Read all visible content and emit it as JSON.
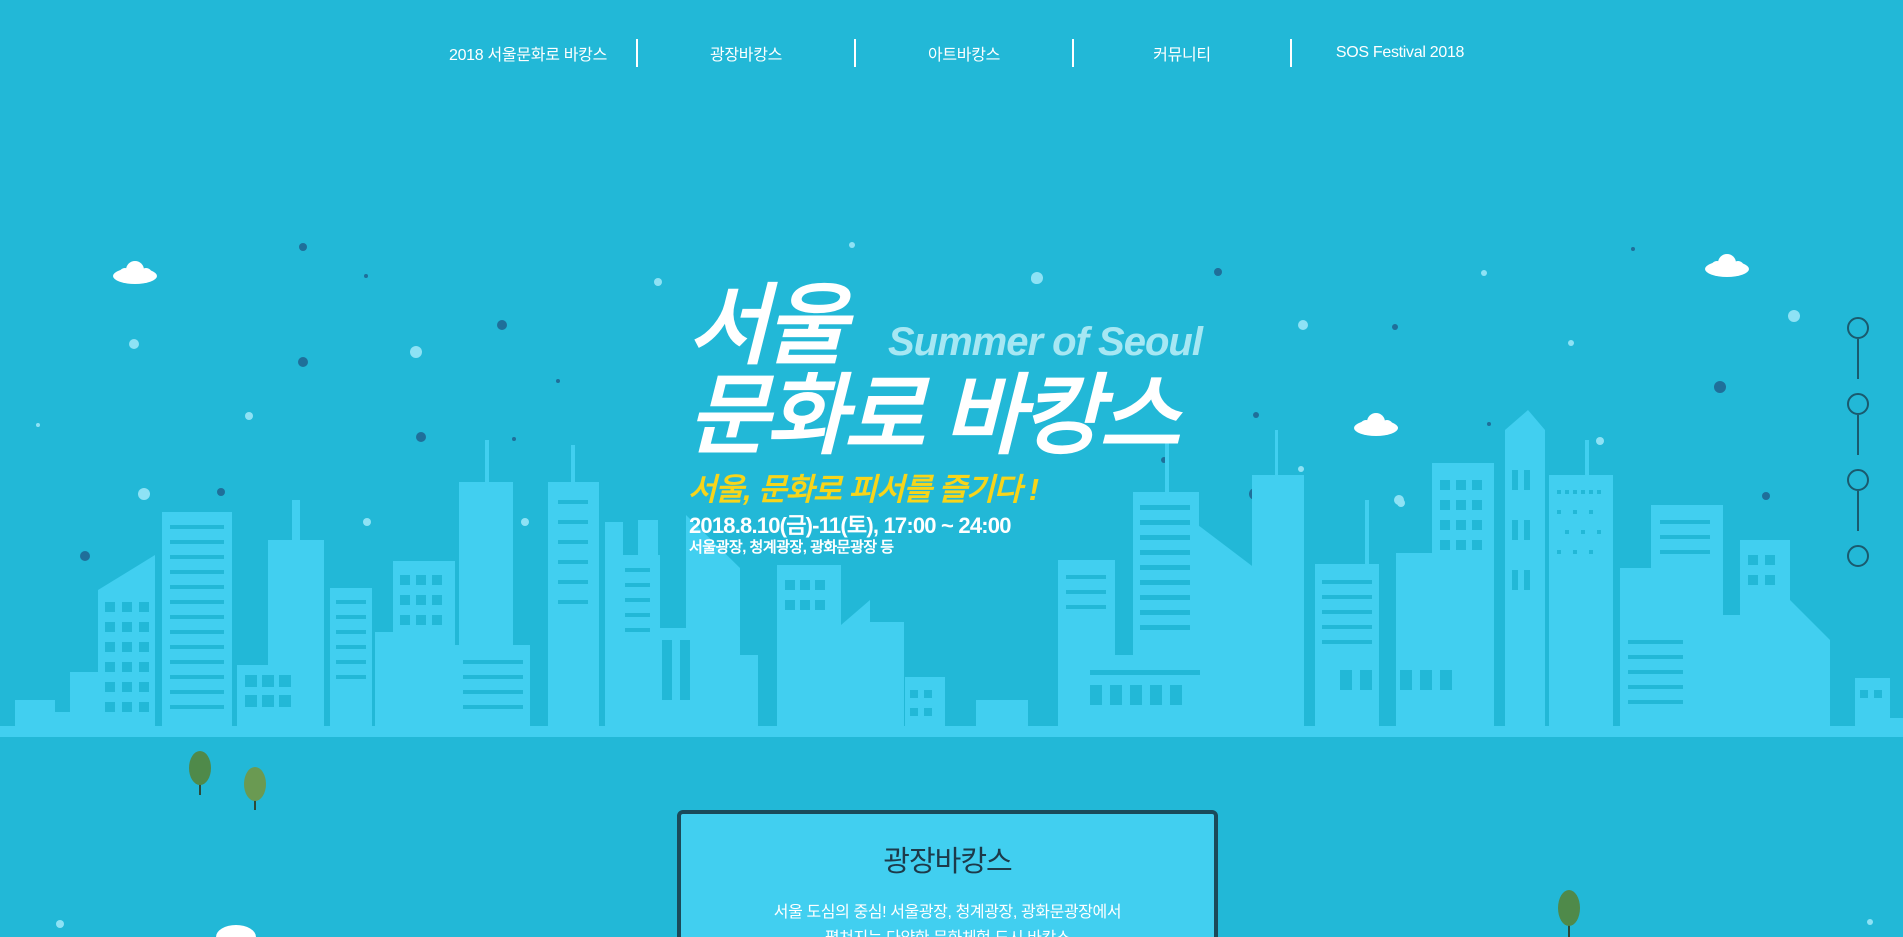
{
  "nav": {
    "items": [
      {
        "label": "2018 서울문화로 바캉스"
      },
      {
        "label": "광장바캉스"
      },
      {
        "label": "아트바캉스"
      },
      {
        "label": "커뮤니티"
      },
      {
        "label": "SOS Festival 2018"
      }
    ]
  },
  "hero": {
    "title_line1": "서울",
    "title_en": "Summer of Seoul",
    "title_line2": "문화로 바캉스",
    "slogan": "서울, 문화로 피서를 즐기다 !",
    "date": "2018.8.10(금)-11(토), 17:00 ~ 24:00",
    "venue": "서울광장, 청계광장, 광화문광장 등"
  },
  "pager": {
    "count": 4,
    "active_index": 0
  },
  "card": {
    "title": "광장바캉스",
    "desc_line1": "서울 도심의 중심! 서울광장, 청계광장, 광화문광장에서",
    "desc_line2": "펼쳐지는 다양한 문화체험 도시 바캉스"
  },
  "colors": {
    "background": "#22b8d7",
    "building": "#41cff0",
    "window": "#22b8d7",
    "slogan": "#f7d51a",
    "accent_dark": "#1a4a5a"
  }
}
